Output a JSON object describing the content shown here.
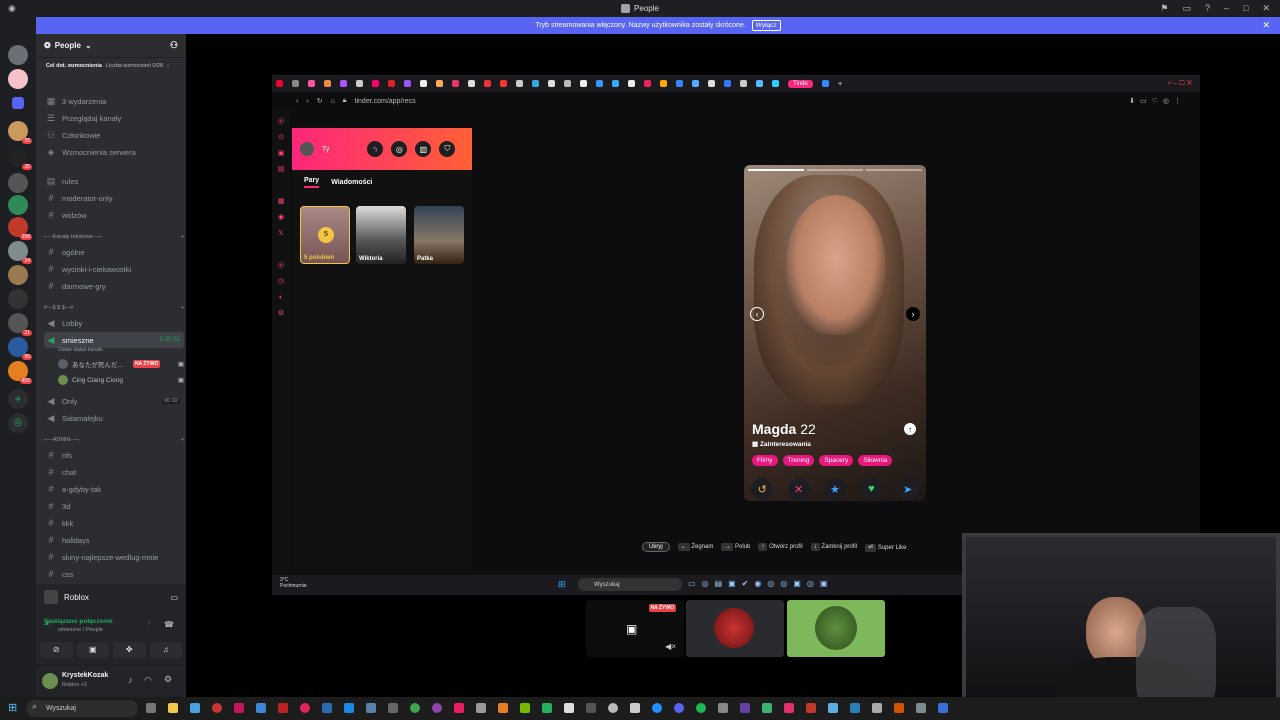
{
  "window": {
    "title": "People"
  },
  "banner": {
    "text": "Tryb streamowania włączony. Nazwy użytkownika zostały skrócone.",
    "button": "Wyłącz"
  },
  "sidebar": {
    "server_name": "People",
    "boost_label": "Cel dot. wzmocnienia",
    "boost_count": "Liczba wzmocnień 0/28",
    "top_items": [
      "3 wydarzenia",
      "Przeglądaj kanały",
      "Członkowie",
      "Wzmocnienia serwera"
    ],
    "channels_a": [
      "rules",
      "moderator-only",
      "widzów"
    ],
    "cat_text": "⌐---Kanały tekstowe---¬",
    "channels_b": [
      "ogólne",
      "wycinki-i-ciekawostki",
      "darmowe-gry"
    ],
    "cat_voice": "#---$ $ $---#",
    "voice": {
      "lobby": "Lobby",
      "current": "smieszne",
      "timer": "5:20:52",
      "status": "Ustaw status kanału",
      "user1": "あなたが死んだ...",
      "live": "NA ŻYWO",
      "user2": "Cing Ciang Ciong",
      "only": "Only",
      "only_count": "00",
      "only_limit": "02",
      "salam": "Salamalejku"
    },
    "cat_admin": "⌐---ADMIN---¬",
    "channels_c": [
      "nfs",
      "chat",
      "a-gdyby-tak",
      "3d",
      "kkk",
      "holidays",
      "skiny-najlepsze-wedlug-mnie",
      "css"
    ],
    "activity": "Roblox",
    "conn_status": "Nawiązano połączenie",
    "conn_where": "smieszne / People",
    "user_name": "KrystekKozak",
    "user_status": "Roblox +2"
  },
  "browser": {
    "url": "tinder.com/app/recs",
    "tab_label": "Tinde"
  },
  "tinder": {
    "user_label": "Ty",
    "tabs": [
      "Pary",
      "Wiadomości"
    ],
    "likes_count": "5",
    "likes_label": "5 polubień",
    "matches": [
      "Wiktoria",
      "Patka"
    ],
    "profile": {
      "name": "Magda",
      "age": "22",
      "interests_label": "Zainteresowania",
      "tags": [
        "Filmy",
        "Trening",
        "Spacery",
        "Siłownia"
      ]
    },
    "hints": [
      "Ukryj",
      "Żegnam",
      "Polub",
      "Otwórz profil",
      "Zamknij profil",
      "Super Like"
    ]
  },
  "inner_taskbar": {
    "temp": "3°C",
    "weather": "Pochmurnie",
    "search": "Wyszukaj"
  },
  "stream_tile": {
    "live": "NA ŻYWO"
  },
  "taskbar": {
    "search": "Wyszukaj"
  },
  "colors": {
    "discord_blurple": "#5865f2",
    "tinder_pink": "#fd267a",
    "tinder_orange": "#ff6036",
    "live_red": "#ed4245",
    "connected_green": "#23a55a"
  }
}
